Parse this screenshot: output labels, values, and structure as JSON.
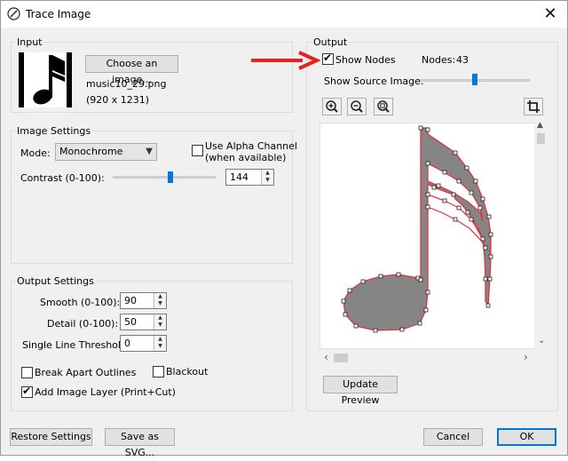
{
  "window": {
    "title": "Trace Image",
    "close_symbol": "✕"
  },
  "input": {
    "group_label": "Input",
    "choose_button": "Choose an image...",
    "file_name": "music10_29.png",
    "file_dims": "(920 x 1231)"
  },
  "image_settings": {
    "group_label": "Image Settings",
    "mode_label": "Mode:",
    "mode_value": "Monochrome",
    "alpha_label_1": "Use Alpha Channel",
    "alpha_label_2": "(when available)",
    "alpha_checked": false,
    "contrast_label": "Contrast (0-100):",
    "contrast_value": "144"
  },
  "output_settings": {
    "group_label": "Output Settings",
    "smooth_label": "Smooth (0-100):",
    "smooth_value": "90",
    "detail_label": "Detail (0-100):",
    "detail_value": "50",
    "threshold_label": "Single Line Threshold:",
    "threshold_value": "0",
    "break_apart_label": "Break Apart Outlines",
    "break_apart_checked": false,
    "blackout_label": "Blackout",
    "blackout_checked": false,
    "add_layer_label": "Add Image Layer (Print+Cut)",
    "add_layer_checked": true
  },
  "output": {
    "group_label": "Output",
    "show_nodes_label": "Show Nodes",
    "show_nodes_checked": true,
    "nodes_label": "Nodes:",
    "nodes_value": "43",
    "show_source_label": "Show Source Image:",
    "update_button": "Update Preview"
  },
  "footer": {
    "restore_button": "Restore Settings",
    "save_svg_button": "Save as SVG...",
    "cancel_button": "Cancel",
    "ok_button": "OK"
  },
  "colors": {
    "accent": "#0078d7",
    "annotation_arrow": "#e8201e",
    "note_fill": "#858585",
    "trace_outline": "#e03040"
  }
}
